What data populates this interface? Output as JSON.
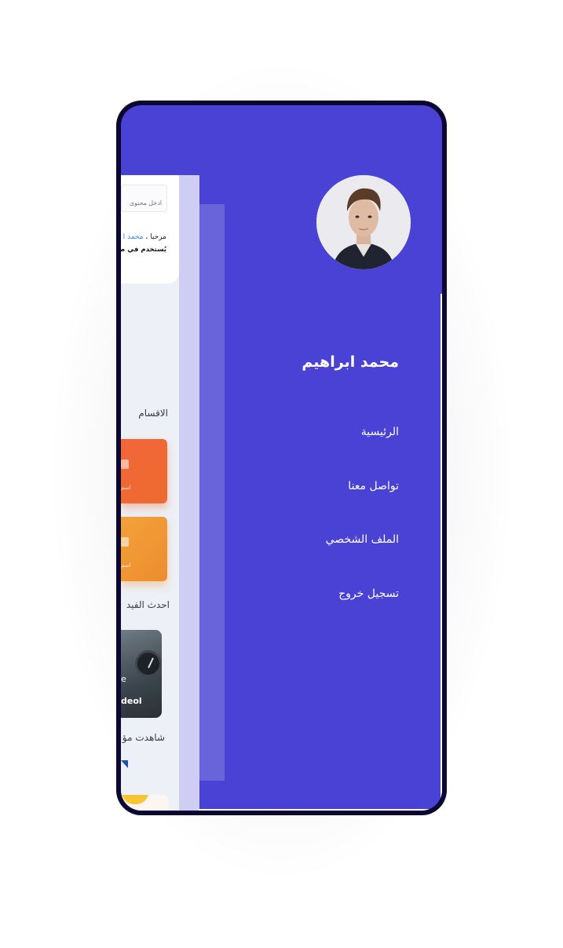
{
  "app": {
    "search": {
      "placeholder": "ادخل محتوى"
    },
    "greeting": {
      "prefix": "مرحبا ،",
      "name": "محمد ا"
    },
    "subtitle": "يُستخدم في صناعة",
    "sections": {
      "categories": "الاقسام",
      "latest_videos": "احدث الفيد",
      "watched": "شاهدت مؤ"
    },
    "categories": [
      {
        "label": "اسم",
        "color": "#f06535"
      },
      {
        "label": "اسم",
        "color": "#f0a035"
      }
    ],
    "video": {
      "line1": "e",
      "line2": "deol"
    }
  },
  "drawer": {
    "user_name": "محمد ابراهيم",
    "menu": [
      {
        "label": "الرئيسية"
      },
      {
        "label": "تواصل معنا"
      },
      {
        "label": "الملف الشخصي"
      },
      {
        "label": "تسجيل خروج"
      }
    ],
    "colors": {
      "background": "#4a42d4",
      "text": "#ffffff"
    }
  }
}
